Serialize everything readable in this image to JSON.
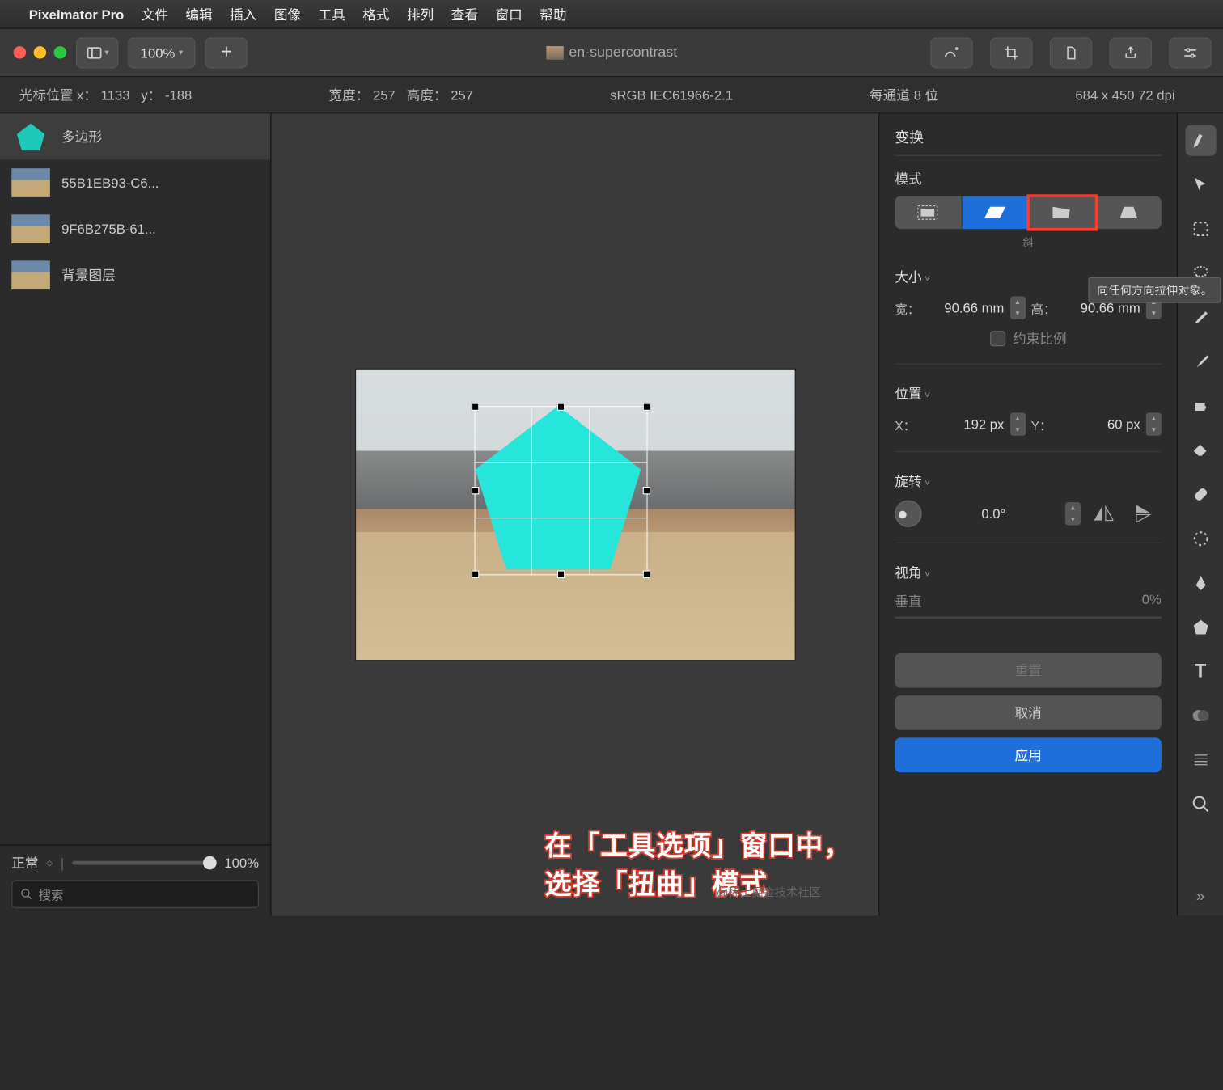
{
  "menubar": {
    "app": "Pixelmator Pro",
    "items": [
      "文件",
      "编辑",
      "插入",
      "图像",
      "工具",
      "格式",
      "排列",
      "查看",
      "窗口",
      "帮助"
    ]
  },
  "toolbar": {
    "zoom": "100%",
    "doc_title": "en-supercontrast"
  },
  "infobar": {
    "cursor_label": "光标位置 x：",
    "cursor_x": "1133",
    "cursor_y_label": "y：",
    "cursor_y": "-188",
    "width_label": "宽度：",
    "width": "257",
    "height_label": "高度：",
    "height": "257",
    "colorspace": "sRGB IEC61966-2.1",
    "depth": "每通道 8 位",
    "dims": "684 x 450 72 dpi"
  },
  "layers": {
    "items": [
      {
        "name": "多边形",
        "kind": "pentagon"
      },
      {
        "name": "55B1EB93-C6...",
        "kind": "img"
      },
      {
        "name": "9F6B275B-61...",
        "kind": "img"
      },
      {
        "name": "背景图层",
        "kind": "img"
      }
    ],
    "blend": "正常",
    "opacity": "100%",
    "search_placeholder": "搜索"
  },
  "inspector": {
    "transform": "变换",
    "mode": "模式",
    "mode_caption": "斜",
    "tooltip": "向任何方向拉伸对象。",
    "size": "大小",
    "w_label": "宽：",
    "w_val": "90.66 mm",
    "h_label": "高：",
    "h_val": "90.66 mm",
    "constrain": "约束比例",
    "position": "位置",
    "x_label": "X：",
    "x_val": "192 px",
    "y_label": "Y：",
    "y_val": "60 px",
    "rotation": "旋转",
    "angle": "0.0°",
    "perspective": "视角",
    "persp_v": "垂直",
    "persp_v_val": "0%",
    "reset": "重置",
    "cancel": "取消",
    "apply": "应用"
  },
  "caption": "在「工具选项」窗口中，选择「扭曲」模式",
  "watermark": "@稀土掘金技术社区"
}
